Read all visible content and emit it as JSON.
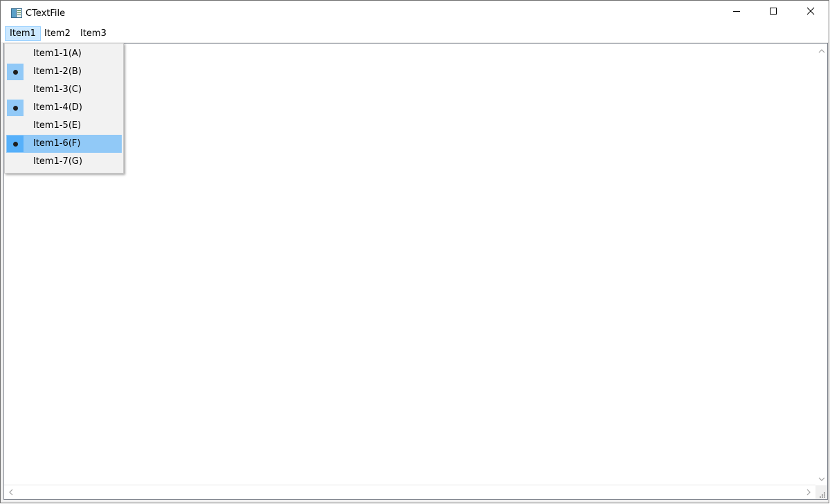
{
  "window": {
    "title": "CTextFile"
  },
  "menubar": {
    "items": [
      {
        "label": "Item1"
      },
      {
        "label": "Item2"
      },
      {
        "label": "Item3"
      }
    ]
  },
  "dropdown": {
    "items": [
      {
        "label": "Item1-1(A)",
        "checked": false,
        "highlighted": false
      },
      {
        "label": "Item1-2(B)",
        "checked": true,
        "highlighted": false
      },
      {
        "label": "Item1-3(C)",
        "checked": false,
        "highlighted": false
      },
      {
        "label": "Item1-4(D)",
        "checked": true,
        "highlighted": false
      },
      {
        "label": "Item1-5(E)",
        "checked": false,
        "highlighted": false
      },
      {
        "label": "Item1-6(F)",
        "checked": true,
        "highlighted": true
      },
      {
        "label": "Item1-7(G)",
        "checked": false,
        "highlighted": false
      }
    ]
  },
  "icons": {
    "app": "app-window-icon",
    "minimize": "minimize-icon",
    "maximize": "maximize-icon",
    "close": "close-icon",
    "bullet": "radio-bullet-icon",
    "scroll_up": "chevron-up-icon",
    "scroll_down": "chevron-down-icon",
    "scroll_left": "chevron-left-icon",
    "scroll_right": "chevron-right-icon",
    "size_grip": "size-grip-icon"
  },
  "colors": {
    "menu_highlight": "#91c9f7",
    "check_background": "#91c9f7",
    "check_highlight": "#56b0fa",
    "active_menu_bg": "#cce8ff",
    "active_menu_border": "#99d1ff"
  }
}
